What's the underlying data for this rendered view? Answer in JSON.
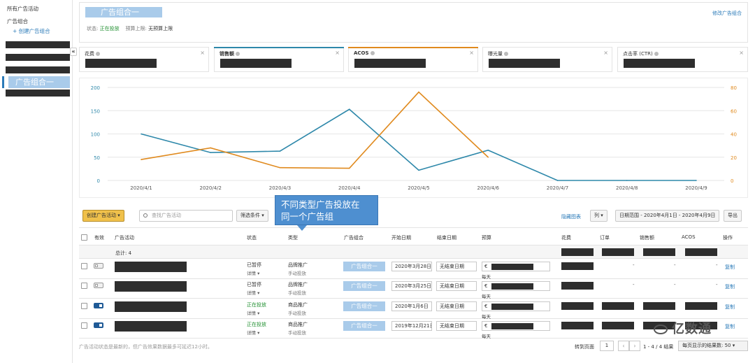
{
  "sidebar": {
    "all_campaigns": "所有广告活动",
    "ad_groups": "广告组合",
    "create_group": "+ 创建广告组合",
    "active_group": "广告组合一",
    "collapse_icon": "«"
  },
  "header": {
    "title": "广告组合一",
    "edit_link": "修改广告组合",
    "status_label": "状态:",
    "status_value": "正在投放",
    "budget_label": "预算上限:",
    "budget_value": "无预算上限"
  },
  "metrics": [
    {
      "label": "花费",
      "color": "",
      "close": "×"
    },
    {
      "label": "销售额",
      "color": "#2e88aa",
      "close": "×"
    },
    {
      "label": "ACOS",
      "color": "#e08a1e",
      "close": "×"
    },
    {
      "label": "曝光量",
      "color": "",
      "close": "×"
    },
    {
      "label": "点击率 (CTR)",
      "color": "",
      "close": "×"
    }
  ],
  "chart_data": {
    "type": "line",
    "categories": [
      "2020/4/1",
      "2020/4/2",
      "2020/4/3",
      "2020/4/4",
      "2020/4/5",
      "2020/4/6",
      "2020/4/7",
      "2020/4/8",
      "2020/4/9"
    ],
    "series": [
      {
        "name": "销售额",
        "axis": "left",
        "color": "#2e88aa",
        "values": [
          100,
          60,
          63,
          153,
          22,
          65,
          0,
          0,
          0
        ]
      },
      {
        "name": "ACOS",
        "axis": "right",
        "color": "#e08a1e",
        "values": [
          18,
          28,
          11,
          10.5,
          76,
          20,
          null,
          null,
          null
        ]
      }
    ],
    "y_left": {
      "ticks": [
        0,
        50,
        100,
        150,
        200
      ],
      "lim": [
        0,
        200
      ]
    },
    "y_right": {
      "ticks": [
        0,
        20,
        40,
        60,
        80
      ],
      "lim": [
        0,
        80
      ]
    },
    "grid": "horizontal"
  },
  "toolbar": {
    "create_campaign": "创建广告活动 ▾",
    "search_placeholder": "查找广告活动",
    "filter": "筛选条件 ▾",
    "hide_chart": "隐藏图表",
    "columns": "列 ▾",
    "date_range": "日期范围 - 2020年4月1日 - 2020年4月9日",
    "export": "导出"
  },
  "callout": {
    "line1": "不同类型广告投放在",
    "line2": "同一个广告组"
  },
  "table": {
    "headers": {
      "active": "有效",
      "campaign": "广告活动",
      "status": "状态",
      "type": "类型",
      "group": "广告组合",
      "start": "开始日期",
      "end": "结束日期",
      "budget": "预算",
      "spend": "花费",
      "orders": "订单",
      "sales": "销售额",
      "acos": "ACOS",
      "action": "操作"
    },
    "total_label": "总计: 4",
    "rows": [
      {
        "enabled": false,
        "status": "已暂停",
        "status_sub": "详情 ▾",
        "type": "品牌推广",
        "type_sub": "手动投放",
        "group": "广告组合一",
        "start": "2020年3月28日",
        "end": "无结束日期",
        "currency": "€",
        "daily": "每天",
        "orders": "-",
        "sales": "-",
        "acos": "-",
        "action": "复制"
      },
      {
        "enabled": false,
        "status": "已暂停",
        "status_sub": "详情 ▾",
        "type": "品牌推广",
        "type_sub": "手动投放",
        "group": "广告组合一",
        "start": "2020年3月25日",
        "end": "无结束日期",
        "currency": "€",
        "daily": "每天",
        "orders": "-",
        "sales": "-",
        "acos": "-",
        "action": "复制"
      },
      {
        "enabled": true,
        "status": "正在投放",
        "status_sub": "详情 ▾",
        "type": "商品推广",
        "type_sub": "手动投放",
        "group": "广告组合一",
        "start": "2020年1月6日",
        "end": "无结束日期",
        "currency": "€",
        "daily": "每天",
        "orders": "",
        "sales": "",
        "acos": "",
        "action": "复制"
      },
      {
        "enabled": true,
        "status": "正在投放",
        "status_sub": "详情 ▾",
        "type": "商品推广",
        "type_sub": "手动投放",
        "group": "广告组合一",
        "start": "2019年12月21日",
        "end": "无结束日期",
        "currency": "€",
        "daily": "每天",
        "orders": "",
        "sales": "",
        "acos": "",
        "action": "复制"
      }
    ]
  },
  "footer": {
    "note": "广告活动状态是最新的，但广告效果数据最多可延迟12小时。",
    "goto_label": "转到页面",
    "page": "1",
    "prev": "‹",
    "next": "›",
    "result_count": "1 - 4 / 4 结果",
    "per_page": "每页显示的结果数: 50 ▾"
  },
  "watermark": "亿数通"
}
